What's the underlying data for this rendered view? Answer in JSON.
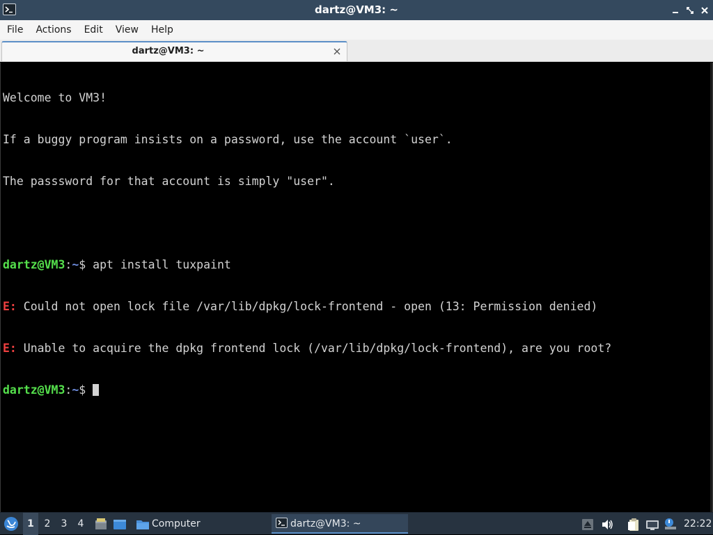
{
  "window": {
    "title": "dartz@VM3: ~"
  },
  "menu": {
    "items": [
      "File",
      "Actions",
      "Edit",
      "View",
      "Help"
    ]
  },
  "tabs": [
    {
      "label": "dartz@VM3: ~"
    }
  ],
  "terminal": {
    "welcome": [
      "Welcome to VM3!",
      "If a buggy program insists on a password, use the account `user`.",
      "The passsword for that account is simply \"user\"."
    ],
    "prompt": {
      "user_host": "dartz@VM3",
      "sep": ":",
      "path": "~",
      "symbol": "$ "
    },
    "command": "apt install tuxpaint",
    "errors": [
      {
        "prefix": "E:",
        "text": " Could not open lock file /var/lib/dpkg/lock-frontend - open (13: Permission denied)"
      },
      {
        "prefix": "E:",
        "text": " Unable to acquire the dpkg frontend lock (/var/lib/dpkg/lock-frontend), are you root?"
      }
    ]
  },
  "taskbar": {
    "workspaces": [
      "1",
      "2",
      "3",
      "4"
    ],
    "active_workspace": "1",
    "computer_label": "Computer",
    "task": {
      "label": "dartz@VM3: ~"
    },
    "clock": "22:22"
  },
  "colors": {
    "titlebar": "#34495e",
    "prompt_user": "#55e04c",
    "prompt_path": "#6f8ee0",
    "error": "#ef4040",
    "taskbar": "#273340"
  }
}
